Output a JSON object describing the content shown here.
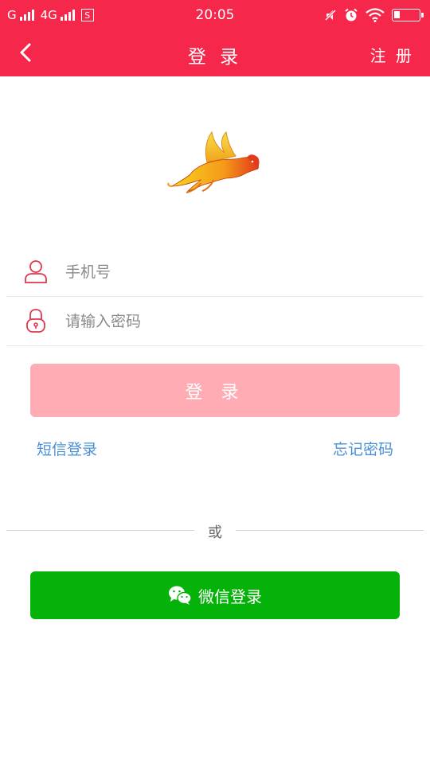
{
  "status_bar": {
    "carrier_1": "G",
    "carrier_2": "4G",
    "extra_icon": "S",
    "time": "20:05",
    "icons": [
      "signal-icon",
      "sim-icon",
      "mute-icon",
      "alarm-icon",
      "wifi-icon",
      "battery-icon"
    ]
  },
  "nav": {
    "back_icon": "chevron-left-icon",
    "title": "登 录",
    "register": "注 册"
  },
  "logo": {
    "icon": "winged-lion-logo"
  },
  "form": {
    "phone": {
      "placeholder": "手机号",
      "value": "",
      "icon": "user-icon"
    },
    "password": {
      "placeholder": "请输入密码",
      "value": "",
      "icon": "lock-icon"
    },
    "login_button": "登 录"
  },
  "links": {
    "sms_login": "短信登录",
    "forgot_password": "忘记密码"
  },
  "divider": {
    "text": "或"
  },
  "wechat": {
    "label": "微信登录",
    "icon": "wechat-icon"
  },
  "colors": {
    "header": "#f5274a",
    "login_button_disabled": "#ffacb5",
    "link": "#4a8fd6",
    "wechat": "#05b20a",
    "icon_accent": "#e0384c"
  }
}
